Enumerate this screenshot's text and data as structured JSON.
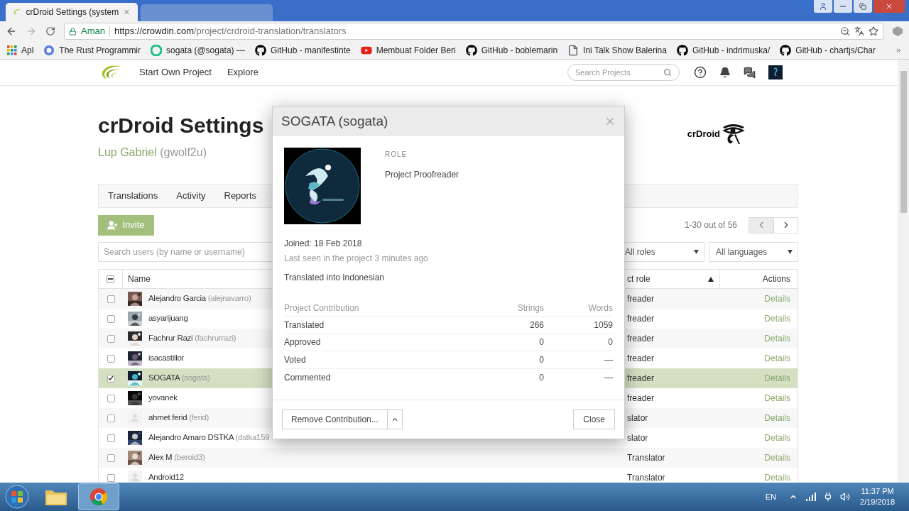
{
  "browser": {
    "tabs": [
      {
        "title": "crDroid Settings (system",
        "selected": true
      },
      {
        "selected": false
      }
    ],
    "secure_label": "Aman",
    "url_origin": "https://crowdin.com",
    "url_path": "/project/crdroid-translation/translators",
    "bookmarks": [
      {
        "label": "Apl",
        "kind": "apps"
      },
      {
        "label": "The Rust Programmir",
        "kind": "rust"
      },
      {
        "label": "sogata (@sogata) —",
        "kind": "sogata"
      },
      {
        "label": "GitHub - manifestinte",
        "kind": "github"
      },
      {
        "label": "Membuat Folder Beri",
        "kind": "youtube"
      },
      {
        "label": "GitHub - boblemarin",
        "kind": "github"
      },
      {
        "label": "Ini Talk Show Balerina",
        "kind": "page"
      },
      {
        "label": "GitHub - indrimuska/",
        "kind": "github"
      },
      {
        "label": "GitHub - chartjs/Char",
        "kind": "github"
      }
    ]
  },
  "site_nav": {
    "links": [
      "Start Own Project",
      "Explore"
    ],
    "search_placeholder": "Search Projects"
  },
  "project": {
    "title": "crDroid Settings",
    "owner": "Lup Gabriel",
    "owner_username": "(gwolf2u)",
    "logo_text": "crDroid"
  },
  "tabs": [
    {
      "label": "Translations"
    },
    {
      "label": "Activity"
    },
    {
      "label": "Reports"
    }
  ],
  "invite_button": "Invite",
  "pagination": "1-30 out of 56",
  "search_users": {
    "placeholder": "Search users (by name or username)"
  },
  "filters": [
    "All roles",
    "All languages"
  ],
  "table": {
    "select_all": {
      "indeterminate": true
    },
    "columns": [
      "Name",
      "ct role",
      "Actions"
    ],
    "rows": [
      {
        "name": "Alejandro Garcia",
        "username": "(alejnavarro)",
        "role": "freader",
        "action": "Details",
        "checked": false,
        "selected": false
      },
      {
        "name": "asyarijuang",
        "role": "freader",
        "action": "Details",
        "checked": false,
        "selected": false
      },
      {
        "name": "Fachrur Razi",
        "username": "(fachrurrazi)",
        "role": "freader",
        "action": "Details",
        "checked": false,
        "selected": false
      },
      {
        "name": "isacastillor",
        "role": "freader",
        "action": "Details",
        "checked": false,
        "selected": false
      },
      {
        "name": "SOGATA",
        "username": "(sogata)",
        "role": "freader",
        "action": "Details",
        "checked": true,
        "selected": true
      },
      {
        "name": "yovanek",
        "role": "freader",
        "action": "Details",
        "checked": false,
        "selected": false
      },
      {
        "name": "ahmet ferid",
        "username": "(ferid)",
        "role": "slator",
        "action": "Details",
        "kind": "default",
        "checked": false,
        "selected": false
      },
      {
        "name": "Alejandro Amaro DSTKA",
        "username": "(dstka159",
        "role": "slator",
        "action": "Details",
        "checked": false,
        "selected": false
      },
      {
        "name": "Alex M",
        "username": "(beroid3)",
        "role": "Translator",
        "action": "Details",
        "checked": false,
        "selected": false
      },
      {
        "name": "Android12",
        "role": "Translator",
        "action": "Details",
        "kind": "default",
        "checked": false,
        "selected": false
      }
    ]
  },
  "dialog": {
    "title": "SOGATA (sogata)",
    "role_label": "ROLE",
    "role": "Project Proofreader",
    "joined": "Joined: 18 Feb 2018",
    "last_seen": "Last seen in the project 3 minutes ago",
    "translated_into": "Translated into Indonesian",
    "contribution": {
      "columns": [
        "Project Contribution",
        "Strings",
        "Words"
      ],
      "rows": [
        {
          "label": "Translated",
          "strings": "266",
          "words": "1059"
        },
        {
          "label": "Approved",
          "strings": "0",
          "words": "0"
        },
        {
          "label": "Voted",
          "strings": "0",
          "words": "—"
        },
        {
          "label": "Commented",
          "strings": "0",
          "words": "—"
        }
      ]
    },
    "remove_button": "Remove Contribution...",
    "close_button": "Close"
  },
  "taskbar": {
    "language": "EN",
    "time": "11:37 PM",
    "date": "2/19/2018"
  }
}
